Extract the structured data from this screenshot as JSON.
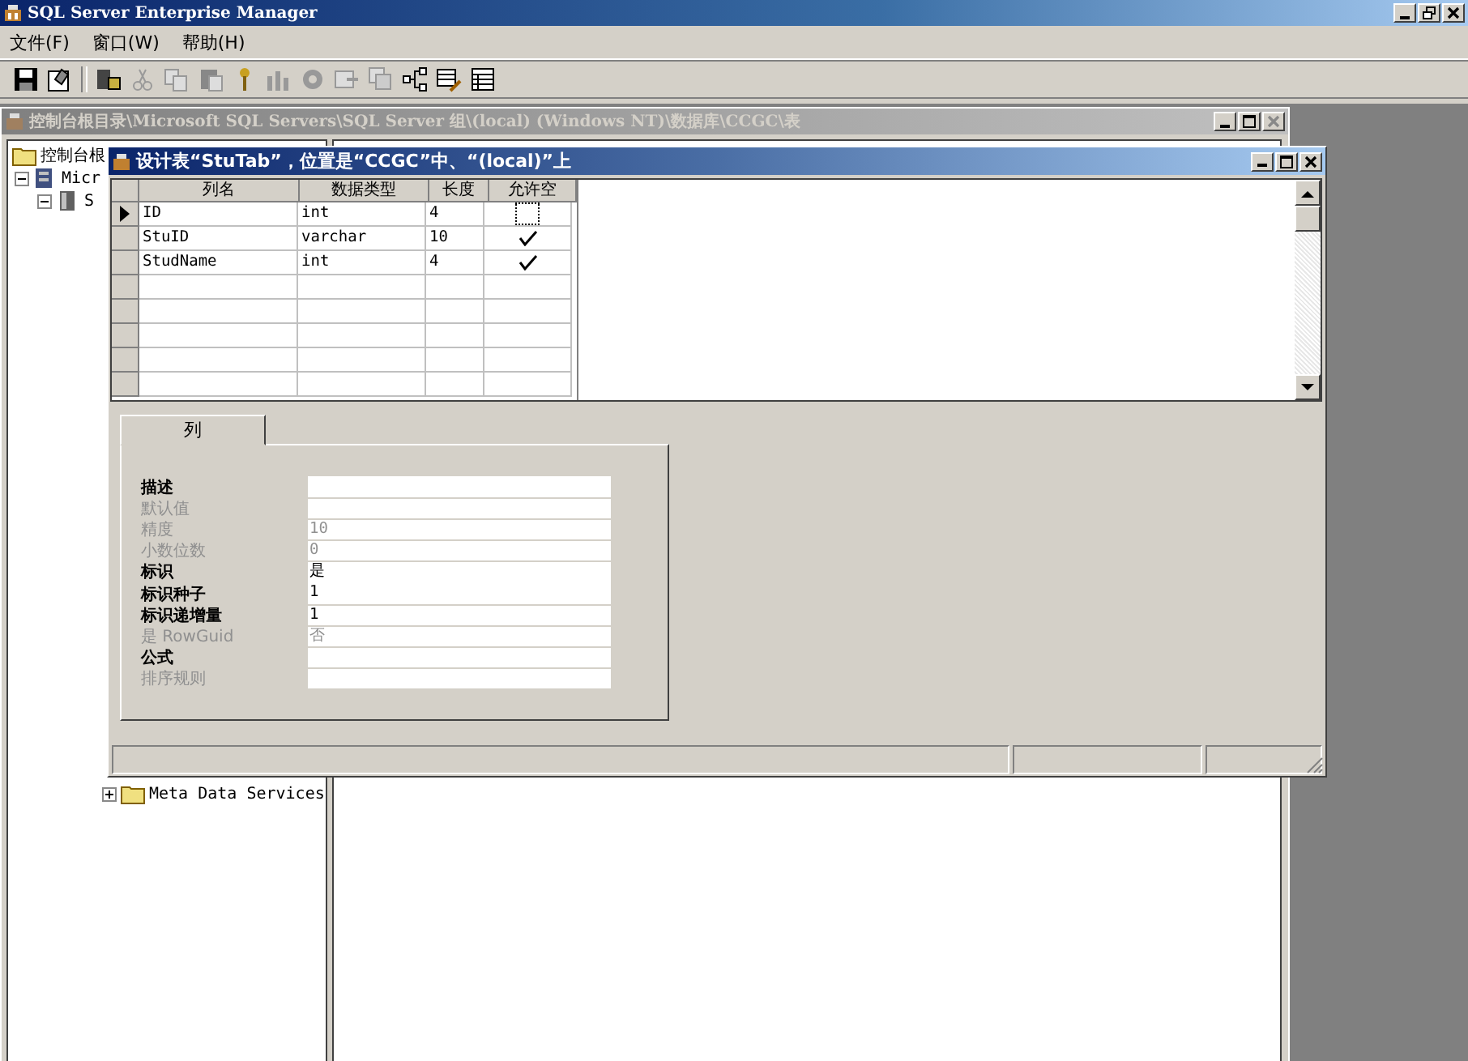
{
  "app": {
    "title": "SQL Server Enterprise Manager"
  },
  "menu": [
    {
      "label": "文件(F)"
    },
    {
      "label": "窗口(W)"
    },
    {
      "label": "帮助(H)"
    }
  ],
  "console_window": {
    "title": "控制台根目录\\Microsoft SQL Servers\\SQL Server 组\\(local) (Windows NT)\\数据库\\CCGC\\表",
    "tree": [
      {
        "label": "控制台根",
        "children": [
          {
            "label": "Micr",
            "expanded": true,
            "children": [
              {
                "label": "S",
                "expanded": true
              }
            ]
          }
        ]
      }
    ],
    "tree_lower": [
      {
        "label": "Meta Data Services",
        "expanded": false
      }
    ]
  },
  "design_window": {
    "title": "设计表“StuTab”，位置是“CCGC”中、“(local)”上",
    "columns": [
      "列名",
      "数据类型",
      "长度",
      "允许空"
    ],
    "rows": [
      {
        "name": "ID",
        "type": "int",
        "length": "4",
        "allow_null": false,
        "selected": true
      },
      {
        "name": "StuID",
        "type": "varchar",
        "length": "10",
        "allow_null": true,
        "selected": false
      },
      {
        "name": "StudName",
        "type": "int",
        "length": "4",
        "allow_null": true,
        "selected": false
      }
    ],
    "tabs": [
      {
        "label": "列",
        "selected": true
      }
    ],
    "properties": [
      {
        "label": "描述",
        "disabled": false
      },
      {
        "label": "默认值",
        "disabled": true
      },
      {
        "label": "精度",
        "value": "10",
        "disabled": true
      },
      {
        "label": "小数位数",
        "value": "0",
        "disabled": true
      },
      {
        "label": "标识",
        "value": "是",
        "disabled": false
      },
      {
        "label": "标识种子",
        "value": "1",
        "disabled": false
      },
      {
        "label": "标识递增量",
        "value": "1",
        "disabled": false
      },
      {
        "label": "是 RowGuid",
        "value": "否",
        "disabled": true
      },
      {
        "label": "公式",
        "disabled": false
      },
      {
        "label": "排序规则",
        "disabled": true
      }
    ]
  }
}
